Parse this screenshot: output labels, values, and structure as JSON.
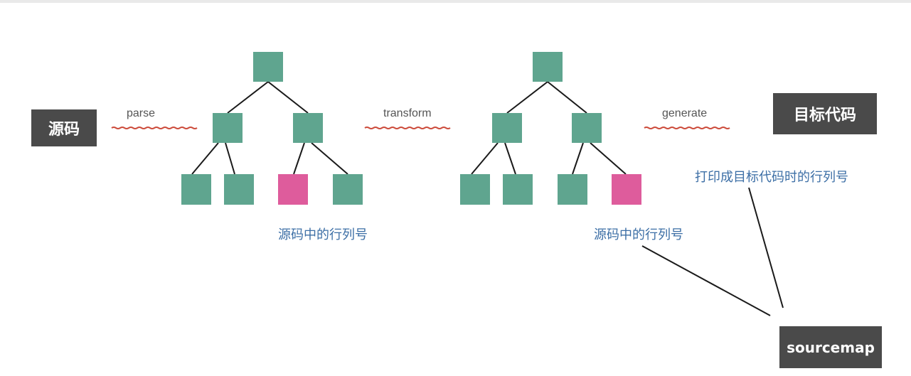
{
  "source_label": "源码",
  "target_label": "目标代码",
  "sourcemap_label": "sourcemap",
  "steps": {
    "parse": "parse",
    "transform": "transform",
    "generate": "generate"
  },
  "annotations": {
    "source_pos_left": "源码中的行列号",
    "source_pos_right": "源码中的行列号",
    "target_pos": "打印成目标代码时的行列号"
  },
  "colors": {
    "node": "#5fa58f",
    "highlight_node": "#de5c9c",
    "box": "#4a4a4a",
    "annotation_text": "#3d6fa6",
    "underline": "#cc4a3a"
  }
}
